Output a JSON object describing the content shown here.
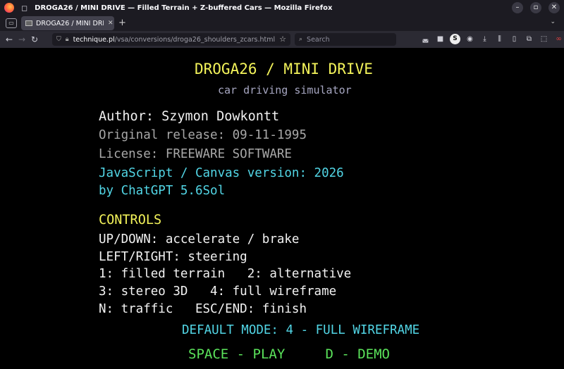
{
  "window": {
    "title": "DROGA26 / MINI DRIVE — Filled Terrain + Z-buffered Cars — Mozilla Firefox"
  },
  "tab": {
    "title": "DROGA26 / MINI DRIVE"
  },
  "navbar": {
    "url_host": "technique.pl",
    "url_path": "/vsa/conversions/droga26_shoulders_zcars.html",
    "search_placeholder": "Search"
  },
  "icons": {
    "window_buttons": [
      "minimize-icon",
      "maximize-icon",
      "close-icon"
    ],
    "toolbar": [
      "pocket-icon",
      "shield-extension-icon",
      "s-extension-icon",
      "account-icon",
      "download-icon",
      "library-icon",
      "sidebar-icon",
      "extensions-icon",
      "screenshot-icon",
      "extension-glasses-icon",
      "menu-icon"
    ]
  },
  "screen": {
    "title": "DROGA26 / MINI DRIVE",
    "subtitle": "car driving simulator",
    "author": "Author: Szymon Dowkontt",
    "release": "Original release: 09-11-1995",
    "license": "License: FREEWARE SOFTWARE",
    "js_version": "JavaScript / Canvas version: 2026",
    "by": "by ChatGPT 5.6Sol",
    "controls_heading": "CONTROLS",
    "controls": [
      "UP/DOWN: accelerate / brake",
      "LEFT/RIGHT: steering",
      "1: filled terrain   2: alternative",
      "3: stereo 3D   4: full wireframe",
      "N: traffic   ESC/END: finish"
    ],
    "default_mode": "DEFAULT MODE: 4 - FULL WIREFRAME",
    "play_prompt": "SPACE - PLAY     D - DEMO"
  },
  "colors": {
    "yellow": "#f3f35a",
    "white": "#f2f2f2",
    "grey": "#a8a8a8",
    "cyan": "#52d6e6",
    "green": "#5be35b",
    "browser_dark": "#1c1b22"
  }
}
